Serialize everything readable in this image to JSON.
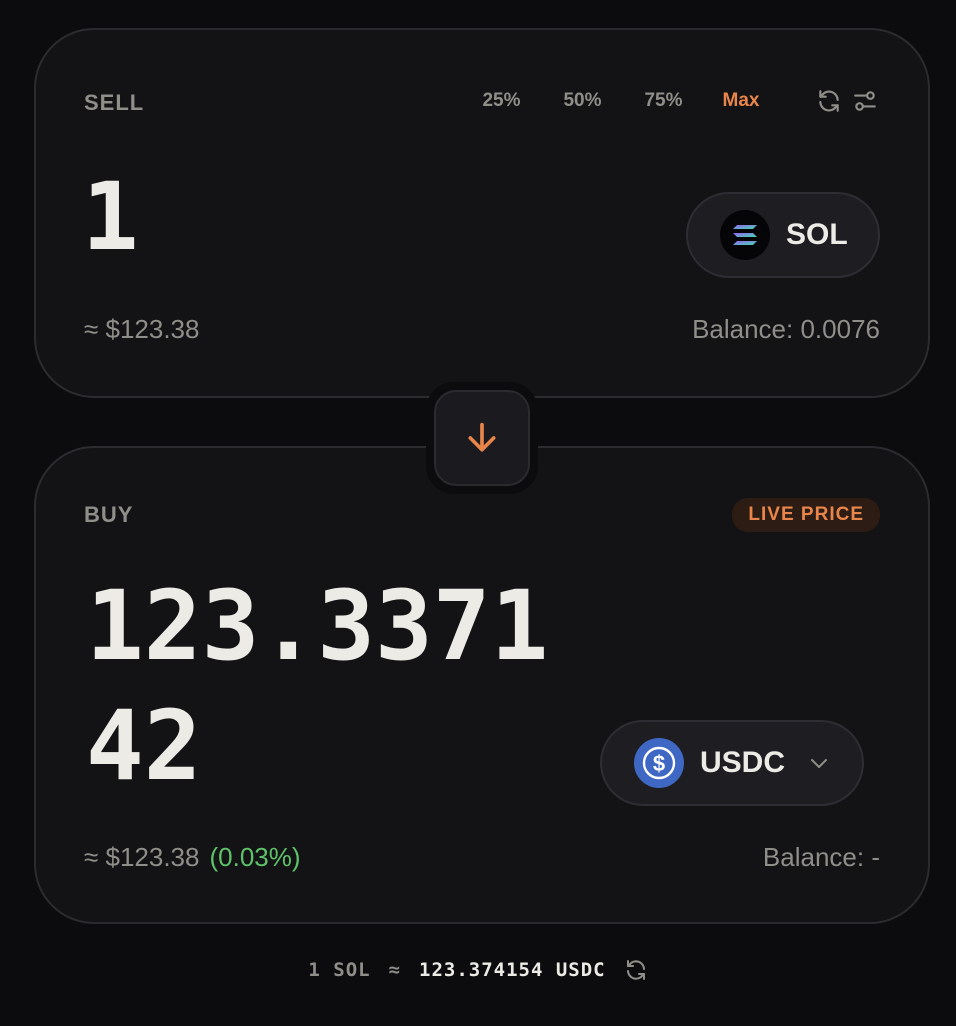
{
  "sell": {
    "label": "SELL",
    "percent_options": [
      "25%",
      "50%",
      "75%"
    ],
    "max_label": "Max",
    "amount": "1",
    "usd_value": "≈ $123.38",
    "balance": "Balance: 0.0076",
    "token": {
      "symbol": "SOL",
      "icon": "solana-logo-icon"
    }
  },
  "swap": {
    "icon": "arrow-down-icon",
    "accent_color": "#e8854a"
  },
  "buy": {
    "label": "BUY",
    "badge": "LIVE PRICE",
    "amount": "123.337142",
    "usd_value": "≈ $123.38",
    "change": "(0.03%)",
    "balance": "Balance: -",
    "token": {
      "symbol": "USDC",
      "icon": "usdc-logo-icon"
    }
  },
  "rate": {
    "from": "1 SOL",
    "approx": "≈",
    "to": "123.374154 USDC"
  },
  "colors": {
    "accent": "#e8854a",
    "positive": "#5ec269",
    "usdc_blue": "#3f68c4"
  }
}
